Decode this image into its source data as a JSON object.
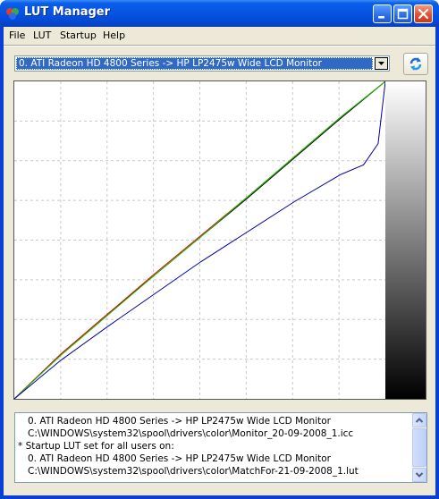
{
  "window": {
    "title": "LUT Manager"
  },
  "menu": {
    "file": "File",
    "lut": "LUT",
    "startup": "Startup",
    "help": "Help"
  },
  "device_select": {
    "selected": "0. ATI Radeon HD 4800 Series  -> HP LP2475w Wide LCD Monitor"
  },
  "chart_data": {
    "type": "line",
    "title": "",
    "xlabel": "",
    "ylabel": "",
    "xlim": [
      0,
      255
    ],
    "ylim": [
      0,
      255
    ],
    "grid": true,
    "grid_divisions": 8,
    "series": [
      {
        "color": "#000000",
        "x": [
          0,
          32,
          64,
          96,
          128,
          160,
          192,
          224,
          255
        ],
        "y": [
          0,
          36,
          68,
          99,
          130,
          161,
          193,
          225,
          255
        ]
      },
      {
        "color": "#ff0000",
        "x": [
          0,
          32,
          64,
          96,
          128,
          160,
          192,
          224,
          255
        ],
        "y": [
          0,
          36,
          68,
          100,
          131,
          162,
          194,
          226,
          255
        ]
      },
      {
        "color": "#00cc00",
        "x": [
          0,
          32,
          64,
          96,
          128,
          160,
          192,
          224,
          255
        ],
        "y": [
          0,
          35,
          67,
          99,
          130,
          162,
          194,
          226,
          255
        ]
      },
      {
        "color": "#0000a0",
        "x": [
          0,
          32,
          64,
          96,
          128,
          160,
          192,
          224,
          240,
          250,
          255
        ],
        "y": [
          0,
          31,
          58,
          84,
          110,
          134,
          158,
          180,
          188,
          205,
          255
        ]
      }
    ]
  },
  "log": {
    "lines": [
      "0. ATI Radeon HD 4800 Series  -> HP LP2475w Wide LCD Monitor",
      "C:\\WINDOWS\\system32\\spool\\drivers\\color\\Monitor_20-09-2008_1.icc",
      "* Startup LUT set for all users on:",
      "0. ATI Radeon HD 4800 Series  -> HP LP2475w Wide LCD Monitor",
      "C:\\WINDOWS\\system32\\spool\\drivers\\color\\MatchFor-21-09-2008_1.lut"
    ]
  }
}
